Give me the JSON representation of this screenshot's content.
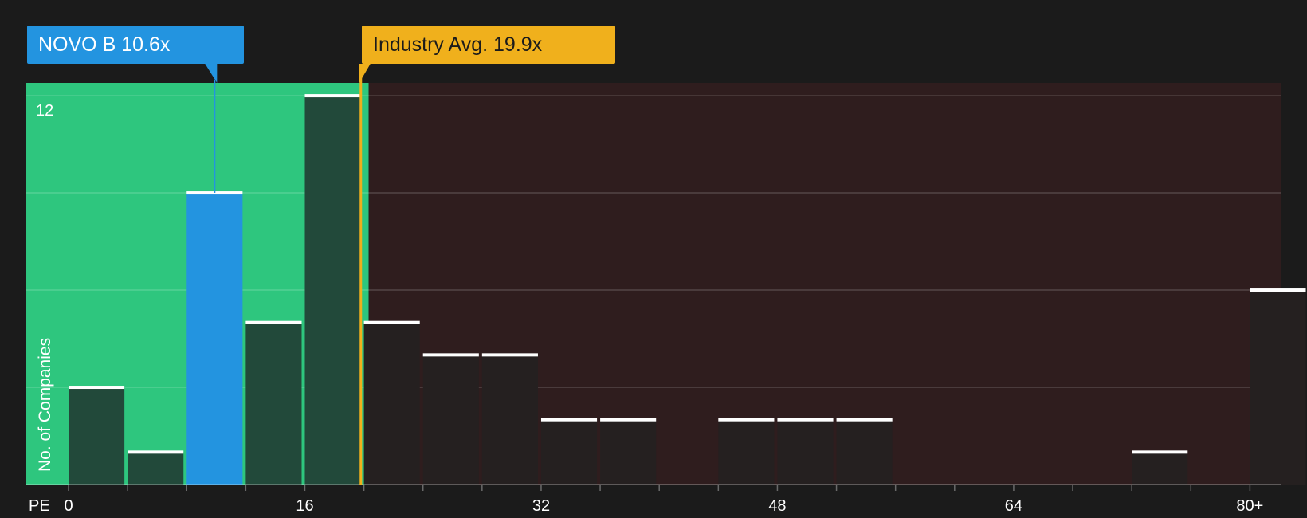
{
  "company_label": "NOVO B 10.6x",
  "industry_label": "Industry Avg. 19.9x",
  "colors": {
    "background": "#1b1b1b",
    "undervalued_zone": "#2ec67e",
    "overvalued_zone": "#2f1d1e",
    "company": "#2394e0",
    "industry": "#f0b01c",
    "bar_in_green": "#22493a",
    "bar_in_red": "#252020"
  },
  "chart_data": {
    "type": "bar",
    "title": "",
    "xlabel": "PE",
    "ylabel": "No. of Companies",
    "x_ticks": [
      "0",
      "16",
      "32",
      "48",
      "64",
      "80+"
    ],
    "y_ticks": [
      "12"
    ],
    "xlim": [
      0,
      82
    ],
    "ylim": [
      0,
      12.5
    ],
    "bin_width": 4,
    "bins": [
      {
        "x_start": 0,
        "count": 3
      },
      {
        "x_start": 4,
        "count": 1
      },
      {
        "x_start": 8,
        "count": 9
      },
      {
        "x_start": 12,
        "count": 5
      },
      {
        "x_start": 16,
        "count": 12
      },
      {
        "x_start": 20,
        "count": 5
      },
      {
        "x_start": 24,
        "count": 4
      },
      {
        "x_start": 28,
        "count": 4
      },
      {
        "x_start": 32,
        "count": 2
      },
      {
        "x_start": 36,
        "count": 2
      },
      {
        "x_start": 44,
        "count": 2
      },
      {
        "x_start": 48,
        "count": 2
      },
      {
        "x_start": 52,
        "count": 2
      },
      {
        "x_start": 72,
        "count": 1
      },
      {
        "x_start": 80,
        "count": 6
      }
    ],
    "company_value": 10.6,
    "company_bin_start": 8,
    "industry_avg": 19.9,
    "grid": true
  }
}
